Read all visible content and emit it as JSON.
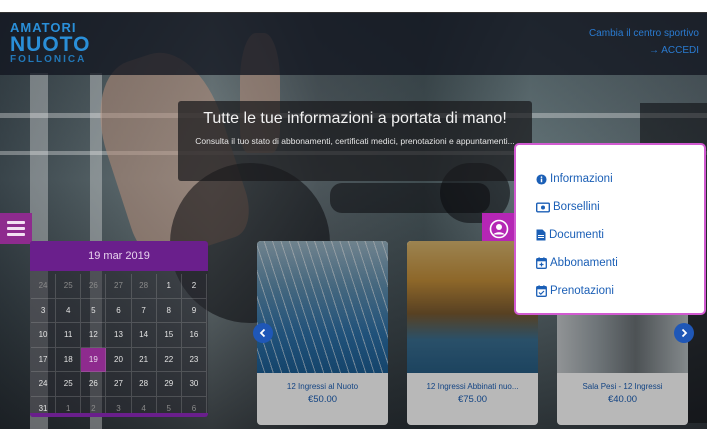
{
  "header": {
    "logo": {
      "line1": "AMATORI",
      "line2": "NUOTO",
      "line3": "FOLLONICA"
    },
    "link_top": "Cambia il centro sportivo",
    "link_bottom": "→ ACCEDI"
  },
  "hero": {
    "title": "Tutte le tue informazioni a portata di mano!",
    "subtitle": "Consulta il tuo stato di abbonamenti, certificati medici, prenotazioni e appuntamenti..."
  },
  "dropdown": {
    "items": [
      {
        "label": "Informazioni",
        "icon": "info-icon"
      },
      {
        "label": "Borsellini",
        "icon": "wallet-icon"
      },
      {
        "label": "Documenti",
        "icon": "document-icon"
      },
      {
        "label": "Abbonamenti",
        "icon": "calendar-icon"
      },
      {
        "label": "Prenotazioni",
        "icon": "calendar-check-icon"
      }
    ]
  },
  "calendar": {
    "header": "19 mar 2019",
    "weeks": [
      [
        "24",
        "25",
        "26",
        "27",
        "28",
        "1",
        "2"
      ],
      [
        "3",
        "4",
        "5",
        "6",
        "7",
        "8",
        "9"
      ],
      [
        "10",
        "11",
        "12",
        "13",
        "14",
        "15",
        "16"
      ],
      [
        "17",
        "18",
        "19",
        "20",
        "21",
        "22",
        "23"
      ],
      [
        "24",
        "25",
        "26",
        "27",
        "28",
        "29",
        "30"
      ],
      [
        "31",
        "1",
        "2",
        "3",
        "4",
        "5",
        "6"
      ]
    ],
    "selected": "19"
  },
  "cards": [
    {
      "name": "12 Ingressi al Nuoto",
      "price": "€50.00"
    },
    {
      "name": "12 Ingressi Abbinati nuo...",
      "price": "€75.00"
    },
    {
      "name": "Sala Pesi - 12 Ingressi",
      "price": "€40.00"
    }
  ],
  "colors": {
    "accent": "#b526b5",
    "primary": "#1b5fb6",
    "calendar_header": "#6a1f8c"
  }
}
